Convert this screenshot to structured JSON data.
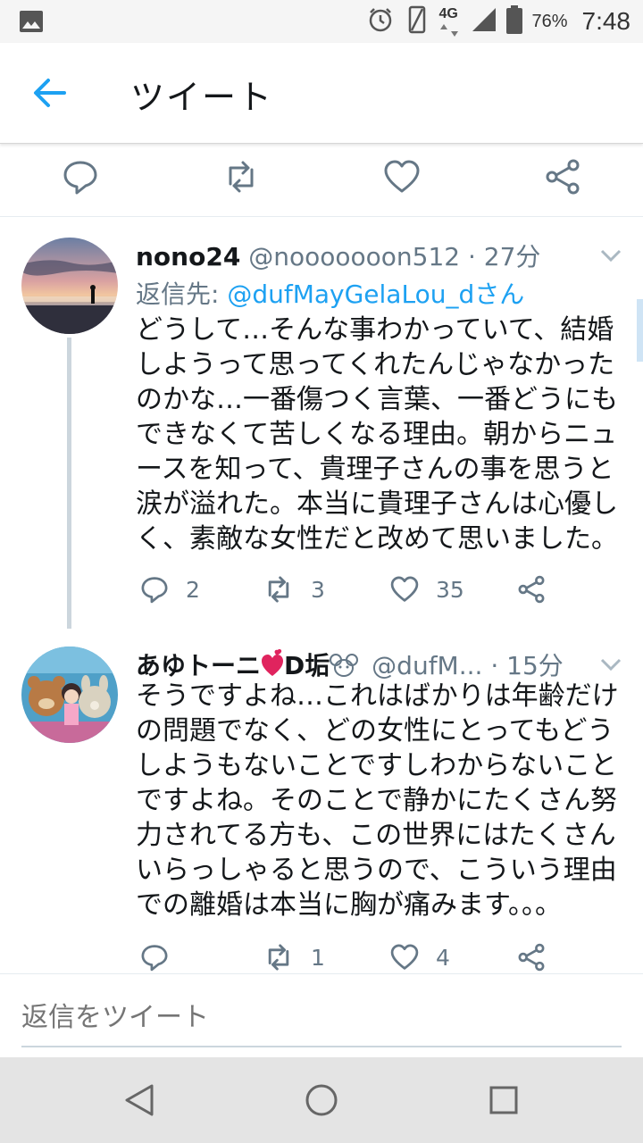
{
  "status_bar": {
    "network": "4G",
    "battery": "76%",
    "time": "7:48"
  },
  "header": {
    "title": "ツイート"
  },
  "replies": [
    {
      "name": "nono24",
      "handle": "@nooooooon512",
      "sep": "·",
      "time": "27分",
      "reply_to_label": "返信先: ",
      "reply_to_handle": "@dufMayGelaLou_dさん",
      "body": "どうして…そんな事わかっていて、結婚しようって思ってくれたんじゃなかったのかな…一番傷つく言葉、一番どうにもできなくて苦しくなる理由。朝からニュースを知って、貴理子さんの事を思うと涙が溢れた。本当に貴理子さんは心優しく、素敵な女性だと改めて思いました。",
      "replies": "2",
      "retweets": "3",
      "likes": "35"
    },
    {
      "name": "あゆトーニ",
      "name_suffix": "D垢",
      "handle": "@dufM...",
      "sep": "·",
      "time": "15分",
      "body": "そうですよね…これはばかりは年齢だけの問題でなく、どの女性にとってもどうしようもないことですしわからないことですよね。そのことで静かにたくさん努力されてる方も、この世界にはたくさんいらっしゃると思うので、こういう理由での離婚は本当に胸が痛みます。。。",
      "replies": "",
      "retweets": "1",
      "likes": "4"
    }
  ],
  "composer": {
    "placeholder": "返信をツイート"
  },
  "colors": {
    "accent": "#1da1f2",
    "secondary_text": "#657786",
    "heart_red": "#e0245e"
  }
}
